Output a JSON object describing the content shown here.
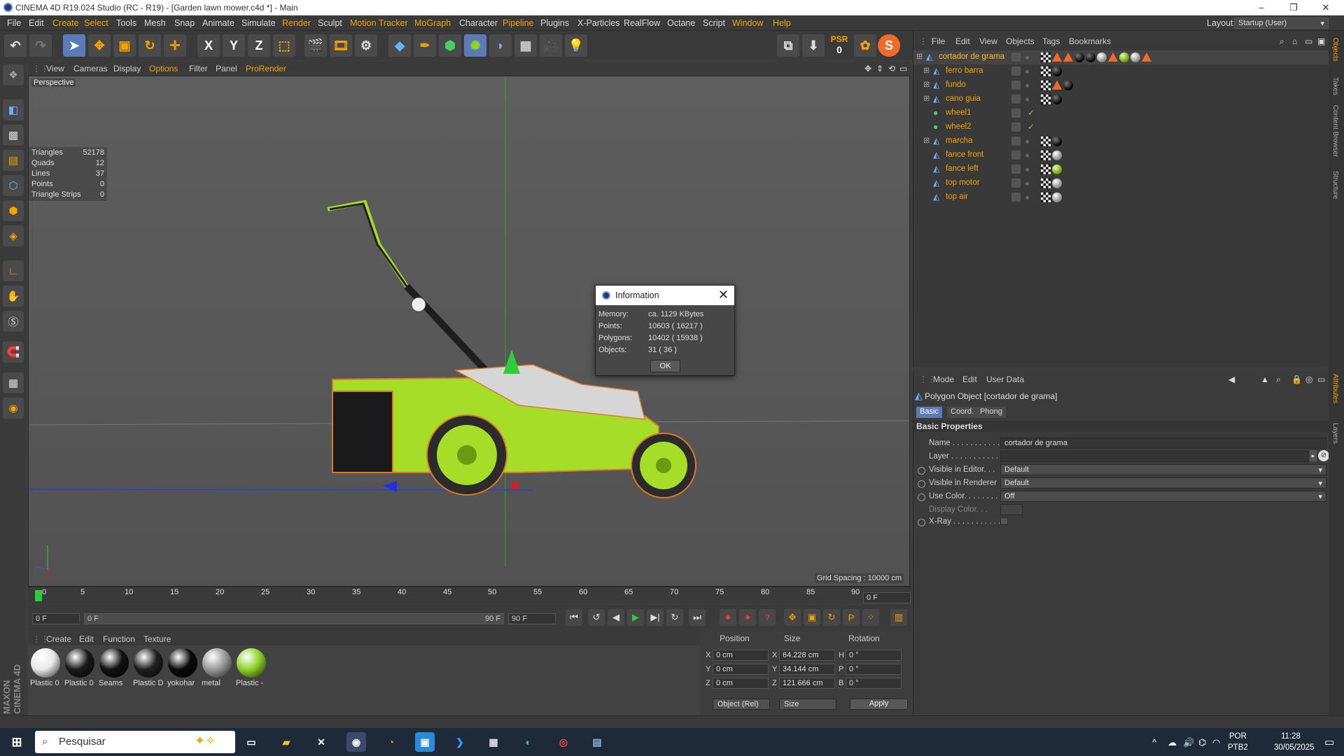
{
  "window": {
    "title": "CINEMA 4D R19.024 Studio (RC - R19) - [Garden lawn mower.c4d *] - Main",
    "controls": [
      "–",
      "❐",
      "✕"
    ]
  },
  "menu": [
    "File",
    "Edit",
    "Create",
    "Select",
    "Tools",
    "Mesh",
    "Snap",
    "Animate",
    "Simulate",
    "Render",
    "Sculpt",
    "Motion Tracker",
    "MoGraph",
    "Character",
    "Pipeline",
    "Plugins",
    "X-Particles",
    "RealFlow",
    "Octane",
    "Script",
    "Window",
    "Help"
  ],
  "layout": {
    "label": "Layout:",
    "value": "Startup (User)"
  },
  "toolbar": {
    "psr_label": "PSR",
    "psr_value": "0",
    "x": "X",
    "y": "Y",
    "z": "Z"
  },
  "viewport": {
    "menu": [
      "View",
      "Cameras",
      "Display",
      "Options",
      "Filter",
      "Panel",
      "ProRender"
    ],
    "label": "Perspective",
    "stats": [
      {
        "k": "Triangles",
        "v": "52178"
      },
      {
        "k": "Quads",
        "v": "12"
      },
      {
        "k": "Lines",
        "v": "37"
      },
      {
        "k": "Points",
        "v": "0"
      },
      {
        "k": "Triangle Strips",
        "v": "0"
      }
    ],
    "grid_spacing": "Grid Spacing : 10000 cm"
  },
  "info_dialog": {
    "title": "Information",
    "rows": [
      {
        "k": "Memory:",
        "v": "ca. 1129 KBytes"
      },
      {
        "k": "Points:",
        "v": "10603 ( 16217 )"
      },
      {
        "k": "Polygons:",
        "v": "10402 ( 15938 )"
      },
      {
        "k": "Objects:",
        "v": "31 ( 36 )"
      }
    ],
    "ok": "OK"
  },
  "timeline": {
    "ticks": [
      "0",
      "5",
      "10",
      "15",
      "20",
      "25",
      "30",
      "35",
      "40",
      "45",
      "50",
      "55",
      "60",
      "65",
      "70",
      "75",
      "80",
      "85",
      "90"
    ],
    "current_frame": "0 F",
    "start": "0 F",
    "range_start": "0 F",
    "range_end": "90 F",
    "end": "90 F"
  },
  "materials": {
    "menu": [
      "Create",
      "Edit",
      "Function",
      "Texture"
    ],
    "items": [
      {
        "name": "Plastic 0",
        "color": "#e8e8e8"
      },
      {
        "name": "Plastic 0",
        "color": "#1a1a1a"
      },
      {
        "name": "Seams",
        "color": "#111111"
      },
      {
        "name": "Plastic D",
        "color": "#202020"
      },
      {
        "name": "yokohar",
        "color": "#0a0a0a"
      },
      {
        "name": "metal",
        "color": "#9a9a9a"
      },
      {
        "name": "Plastic -",
        "color": "#8fd22a"
      }
    ]
  },
  "coords": {
    "headers": [
      "Position",
      "Size",
      "Rotation"
    ],
    "rows": [
      {
        "a": "X",
        "pos": "0 cm",
        "b": "X",
        "size": "64.228 cm",
        "c": "H",
        "rot": "0 °"
      },
      {
        "a": "Y",
        "pos": "0 cm",
        "b": "Y",
        "size": "34.144 cm",
        "c": "P",
        "rot": "0 °"
      },
      {
        "a": "Z",
        "pos": "0 cm",
        "b": "Z",
        "size": "121.666 cm",
        "c": "B",
        "rot": "0 °"
      }
    ],
    "mode": "Object (Rel)",
    "size_mode": "Size",
    "apply": "Apply"
  },
  "object_manager": {
    "menu": [
      "File",
      "Edit",
      "View",
      "Objects",
      "Tags",
      "Bookmarks"
    ],
    "objects": [
      {
        "name": "cortador de grama",
        "tags": [
          "tex",
          "tri",
          "tri",
          "ball-black",
          "ball-black",
          "ball-white",
          "tri",
          "ball-green",
          "ball-white",
          "tri"
        ]
      },
      {
        "name": "ferro barra",
        "tags": [
          "tex",
          "ball-black"
        ]
      },
      {
        "name": "fundo",
        "tags": [
          "tex",
          "tri",
          "ball-black"
        ]
      },
      {
        "name": "cano guia",
        "tags": [
          "tex",
          "ball-black"
        ]
      },
      {
        "name": "wheel1",
        "tags": []
      },
      {
        "name": "wheel2",
        "tags": []
      },
      {
        "name": "marcha",
        "tags": [
          "tex",
          "ball-black"
        ]
      },
      {
        "name": "fance front",
        "tags": [
          "tex",
          "ball-white"
        ]
      },
      {
        "name": "fance left",
        "tags": [
          "tex",
          "ball-green"
        ]
      },
      {
        "name": "top motor",
        "tags": [
          "tex",
          "ball-white"
        ]
      },
      {
        "name": "top air",
        "tags": [
          "tex",
          "ball-white"
        ]
      }
    ]
  },
  "attributes": {
    "menu": [
      "Mode",
      "Edit",
      "User Data"
    ],
    "title": "Polygon Object [cortador de grama]",
    "tabs": [
      "Basic",
      "Coord.",
      "Phong"
    ],
    "section": "Basic Properties",
    "fields": [
      {
        "label": "Name . . . . . . . . . . . .",
        "value": "cortador de grama"
      },
      {
        "label": "Layer . . . . . . . . . . . .",
        "value": ""
      },
      {
        "label": "Visible in Editor. . .",
        "value": "Default"
      },
      {
        "label": "Visible in Renderer",
        "value": "Default"
      },
      {
        "label": "Use Color. . . . . . . .",
        "value": "Off"
      },
      {
        "label": "Display Color. . .",
        "value": ""
      },
      {
        "label": "X-Ray . . . . . . . . . . .",
        "value": ""
      }
    ]
  },
  "side_tabs": [
    "Objects",
    "Takes",
    "Content Browser",
    "Structure",
    "Attributes",
    "Layers"
  ],
  "branding": "MAXON CINEMA 4D",
  "taskbar": {
    "search": "Pesquisar",
    "lang": "POR",
    "kbd": "PTB2",
    "time": "11:28",
    "date": "30/05/2025"
  },
  "colors": {
    "accent_orange": "#f2a300",
    "selected_blue": "#5a7ab8",
    "mower_green": "#a6dd28"
  }
}
